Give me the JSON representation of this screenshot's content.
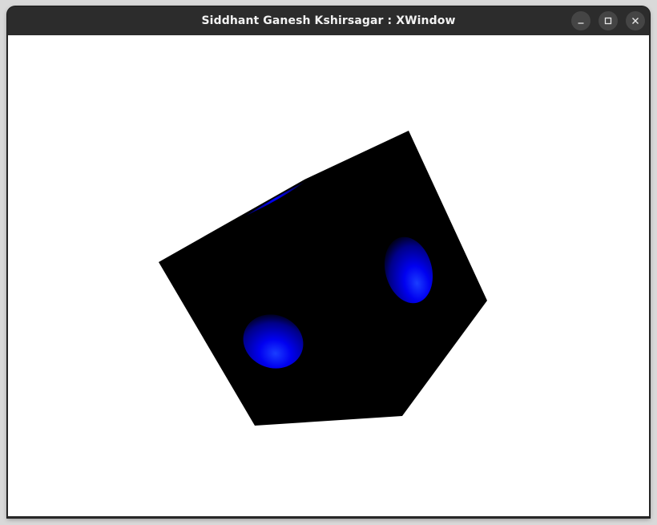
{
  "window": {
    "title": "Siddhant Ganesh Kshirsagar : XWindow",
    "controls": [
      {
        "name": "minimize",
        "icon": "minimize-icon"
      },
      {
        "name": "maximize",
        "icon": "maximize-icon"
      },
      {
        "name": "close",
        "icon": "close-icon"
      }
    ]
  },
  "scene": {
    "background_color": "#ffffff",
    "cube_color": "#000000",
    "pip_color": "#0000ff"
  }
}
